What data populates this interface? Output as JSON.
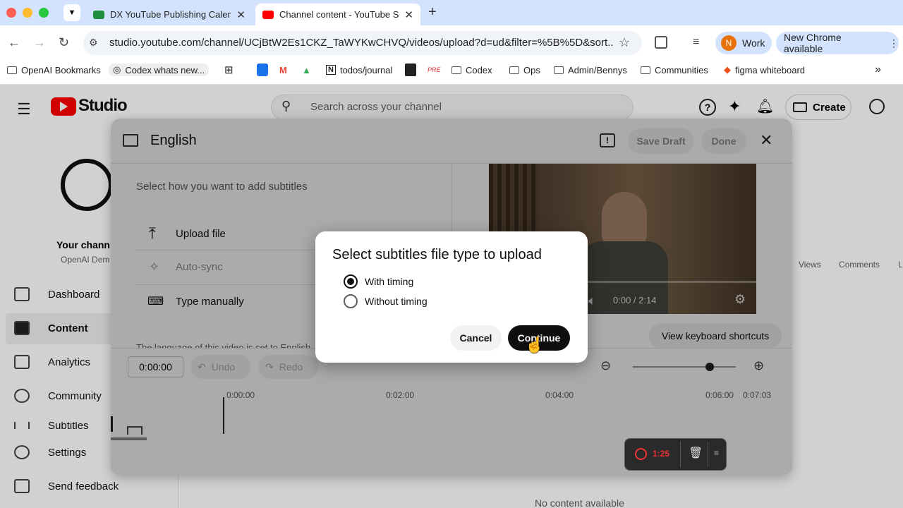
{
  "browser": {
    "tabs": [
      {
        "title": "DX YouTube Publishing Calen",
        "color": "#1e8e3e"
      },
      {
        "title": "Channel content - YouTube St",
        "color": "#ff0000"
      }
    ],
    "url": "studio.youtube.com/channel/UCjBtW2Es1CKZ_TaWYKwCHVQ/videos/upload?d=ud&filter=%5B%5D&sort...",
    "profile_initial": "N",
    "profile_label": "Work",
    "update_label": "New Chrome available",
    "bookmarks": [
      "OpenAI Bookmarks",
      "Codex whats new...",
      "todos/journal",
      "Codex",
      "Ops",
      "Admin/Bennys",
      "Communities",
      "figma whiteboard"
    ]
  },
  "studio": {
    "logo": "Studio",
    "search_placeholder": "Search across your channel",
    "create_label": "Create",
    "channel_name": "Your chann",
    "channel_sub": "OpenAI Dem",
    "nav": [
      "Dashboard",
      "Content",
      "Analytics",
      "Community",
      "Subtitles",
      "Settings",
      "Send feedback"
    ],
    "columns": [
      "Views",
      "Comments",
      "L"
    ],
    "empty": "No content available"
  },
  "editor": {
    "title": "English",
    "save_draft": "Save Draft",
    "done": "Done",
    "prompt": "Select how you want to add subtitles",
    "options": [
      "Upload file",
      "Auto-sync",
      "Type manually"
    ],
    "lang_note": "The language of this video is set to English",
    "video_time": "0:00 / 2:14",
    "shortcuts": "View keyboard shortcuts",
    "timecode": "0:00:00",
    "undo": "Undo",
    "redo": "Redo",
    "ticks": [
      "0:00:00",
      "0:02:00",
      "0:04:00",
      "0:06:00",
      "0:07:03"
    ]
  },
  "dialog": {
    "title": "Select subtitles file type to upload",
    "with_timing": "With timing",
    "without_timing": "Without timing",
    "cancel": "Cancel",
    "continue": "Continue"
  },
  "recorder": {
    "time": "1:25"
  }
}
